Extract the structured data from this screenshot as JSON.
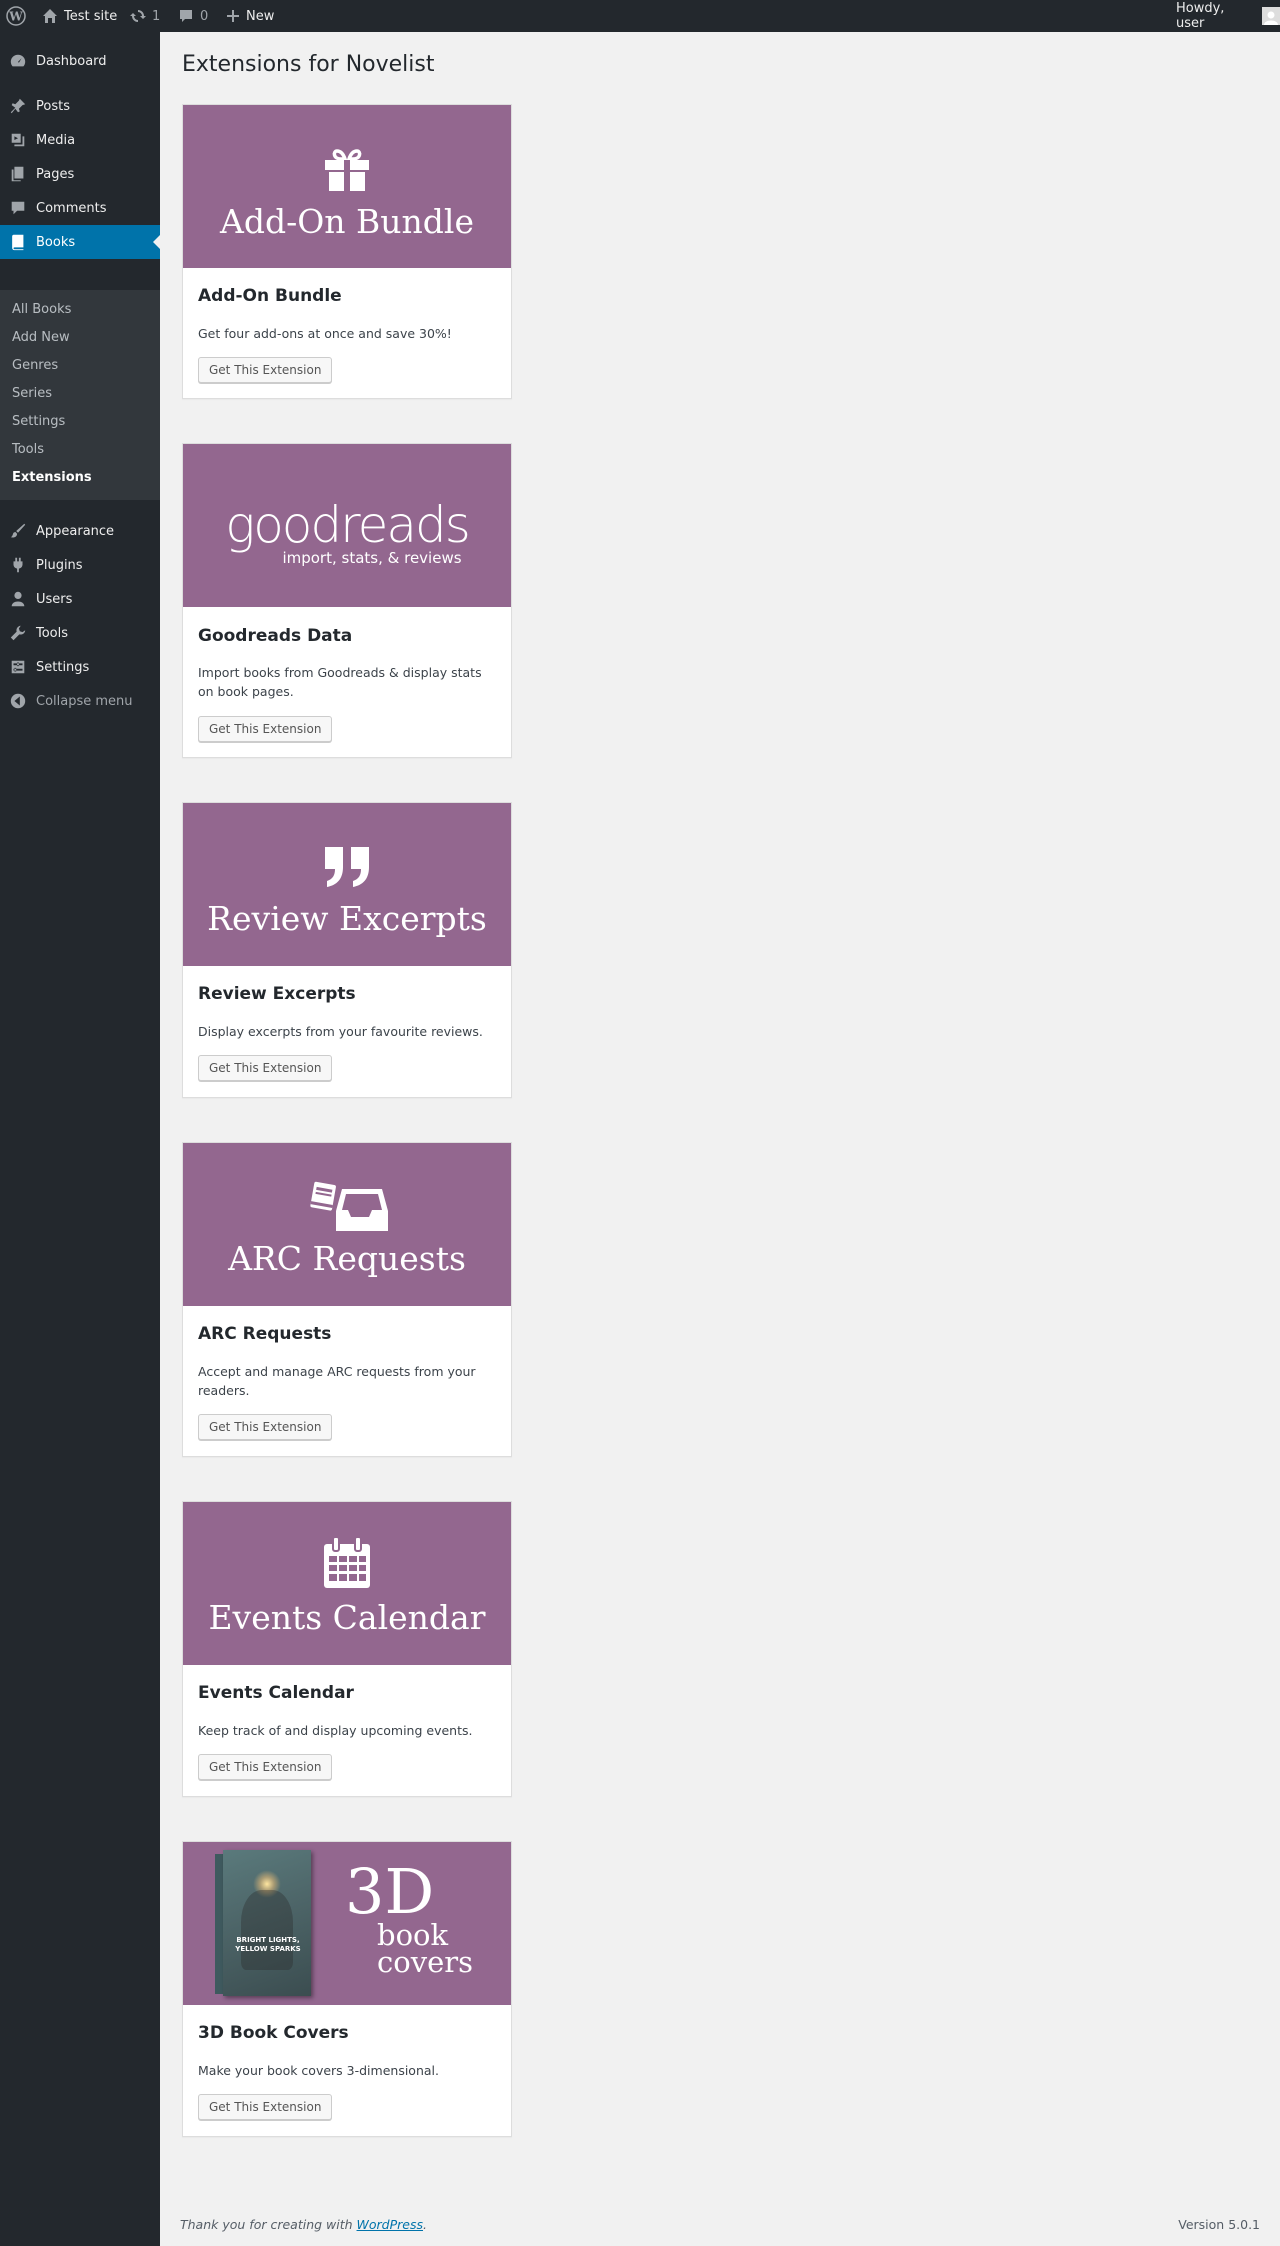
{
  "adminbar": {
    "site_name": "Test site",
    "updates_count": "1",
    "comments_count": "0",
    "new_label": "New",
    "howdy": "Howdy, user"
  },
  "sidebar": {
    "items": [
      {
        "label": "Dashboard",
        "icon": "dashboard-icon"
      },
      {
        "label": "Posts",
        "icon": "pin-icon"
      },
      {
        "label": "Media",
        "icon": "media-icon"
      },
      {
        "label": "Pages",
        "icon": "pages-icon"
      },
      {
        "label": "Comments",
        "icon": "comment-icon"
      },
      {
        "label": "Books",
        "icon": "book-icon"
      },
      {
        "label": "Appearance",
        "icon": "brush-icon"
      },
      {
        "label": "Plugins",
        "icon": "plug-icon"
      },
      {
        "label": "Users",
        "icon": "user-icon"
      },
      {
        "label": "Tools",
        "icon": "wrench-icon"
      },
      {
        "label": "Settings",
        "icon": "settings-icon"
      },
      {
        "label": "Collapse menu",
        "icon": "collapse-icon"
      }
    ],
    "submenu": [
      "All Books",
      "Add New",
      "Genres",
      "Series",
      "Settings",
      "Tools",
      "Extensions"
    ]
  },
  "page": {
    "title": "Extensions for Novelist"
  },
  "extensions": [
    {
      "banner_title": "Add-On Bundle",
      "icon": "gift-icon",
      "title": "Add-On Bundle",
      "description": "Get four add-ons at once and save 30%!",
      "button": "Get This Extension"
    },
    {
      "banner_title": "goodreads",
      "banner_subtitle": "import, stats, & reviews",
      "icon": "goodreads-logo",
      "title": "Goodreads Data",
      "description": "Import books from Goodreads & display stats on book pages.",
      "button": "Get This Extension"
    },
    {
      "banner_title": "Review Excerpts",
      "icon": "quote-icon",
      "title": "Review Excerpts",
      "description": "Display excerpts from your favourite reviews.",
      "button": "Get This Extension"
    },
    {
      "banner_title": "ARC Requests",
      "icon": "inbox-icon",
      "title": "ARC Requests",
      "description": "Accept and manage ARC requests from your readers.",
      "button": "Get This Extension"
    },
    {
      "banner_title": "Events Calendar",
      "icon": "calendar-icon",
      "title": "Events Calendar",
      "description": "Keep track of and display upcoming events.",
      "button": "Get This Extension"
    },
    {
      "banner_title": "3D",
      "banner_subtitle": "book covers",
      "book_cover_text": "BRIGHT LIGHTS, YELLOW SPARKS",
      "icon": "book-cover-image",
      "title": "3D Book Covers",
      "description": "Make your book covers 3-dimensional.",
      "button": "Get This Extension"
    }
  ],
  "footer": {
    "thanks_prefix": "Thank you for creating with",
    "thanks_link": "WordPress",
    "thanks_suffix": ".",
    "version": "Version 5.0.1"
  },
  "colors": {
    "banner": "#93678f",
    "admin_dark": "#23282d",
    "accent": "#0073aa"
  }
}
